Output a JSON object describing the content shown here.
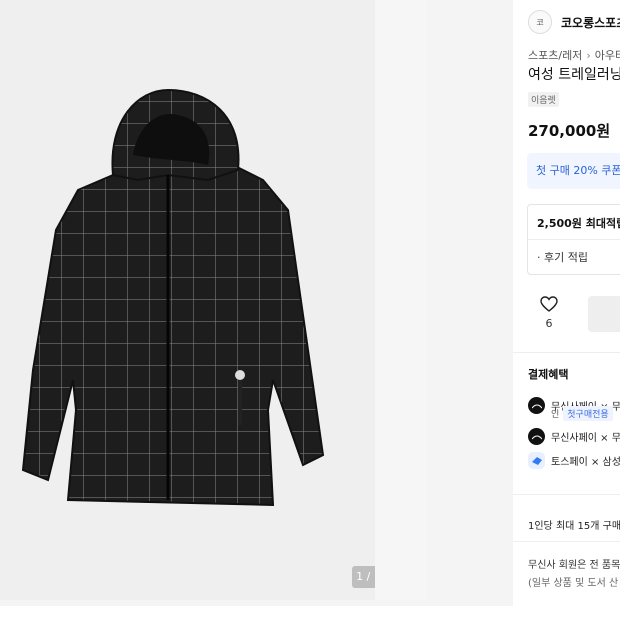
{
  "gallery": {
    "counter": "1 / 10",
    "image_alt": "black check pattern hooded jacket"
  },
  "brand": {
    "logo_text": "코",
    "name": "코오롱스포츠"
  },
  "breadcrumb": [
    "스포츠/레저",
    "아우터"
  ],
  "product": {
    "title": "여성 트레일러닝",
    "tag": "이음렛",
    "price": "270,000원"
  },
  "coupon": {
    "text": "첫 구매 20% 쿠폰 받"
  },
  "points": {
    "title": "2,500원 최대적립",
    "review": "· 후기 적립"
  },
  "like": {
    "count": "6"
  },
  "payment": {
    "title": "결제혜택",
    "rows": [
      {
        "text": "무신사페이 × 무",
        "icon": "musinsa-pay-icon"
      },
      {
        "text": "무신사페이 × 무",
        "icon": "musinsa-pay-icon"
      },
      {
        "text": "토스페이 × 삼성",
        "icon": "toss-pay-icon"
      }
    ],
    "first_badge_prefix": "인",
    "first_badge": "첫구매전용"
  },
  "limit": {
    "text": "1인당 최대 15개 구매"
  },
  "notice": {
    "line1": "무신사 회원은 전 품목",
    "line2": "(일부 상품 및 도서 산"
  }
}
